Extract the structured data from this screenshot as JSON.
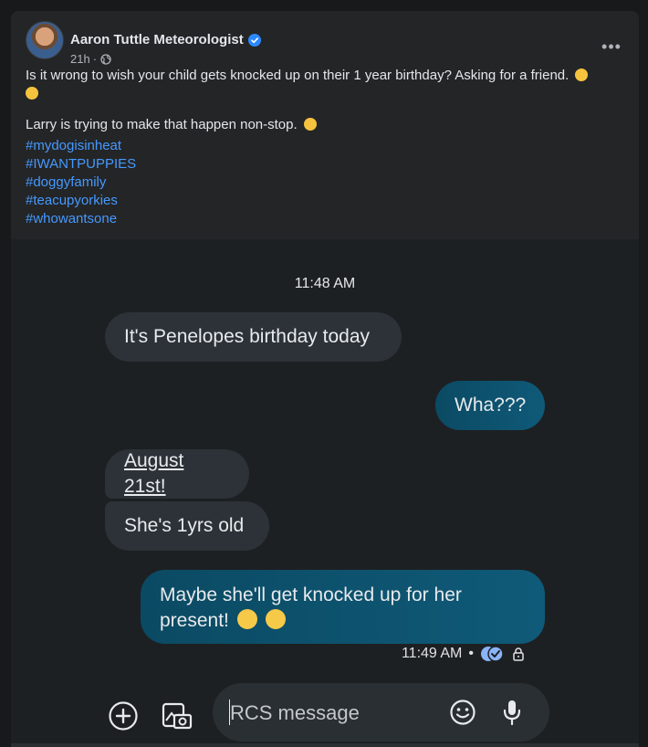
{
  "post": {
    "author": "Aaron Tuttle Meteorologist",
    "time": "21h",
    "separator": "·",
    "more_label": "•••",
    "line1": "Is it wrong to wish your child gets knocked up on their 1 year birthday? Asking for a friend.",
    "line2": "Larry is trying to make that happen non-stop.",
    "hashtags": [
      "#mydogisinheat",
      "#IWANTPUPPIES",
      "#doggyfamily",
      "#teacupyorkies",
      "#whowantsone"
    ]
  },
  "chat": {
    "timestamp_top": "11:48 AM",
    "messages": [
      {
        "text": "It's Penelopes birthday today",
        "direction": "incoming"
      },
      {
        "text": "Wha???",
        "direction": "outgoing"
      },
      {
        "text": "August 21st!",
        "direction": "incoming"
      },
      {
        "text": "She's 1yrs old",
        "direction": "incoming"
      },
      {
        "text": "Maybe she'll get knocked up for her present!",
        "direction": "outgoing"
      }
    ],
    "status_time": "11:49 AM",
    "status_dot": "•",
    "compose_placeholder": "RCS message"
  },
  "colors": {
    "accent_blue": "#4599ff",
    "verified_blue": "#2d88ff",
    "outgoing_bubble": "#0f5a78",
    "incoming_bubble": "#2c3238",
    "read_receipt": "#8ab4f8"
  },
  "icons": [
    "verified-badge-icon",
    "globe-icon",
    "more-options-icon",
    "read-receipt-icon",
    "lock-icon",
    "add-icon",
    "gallery-icon",
    "emoji-icon",
    "microphone-icon"
  ]
}
